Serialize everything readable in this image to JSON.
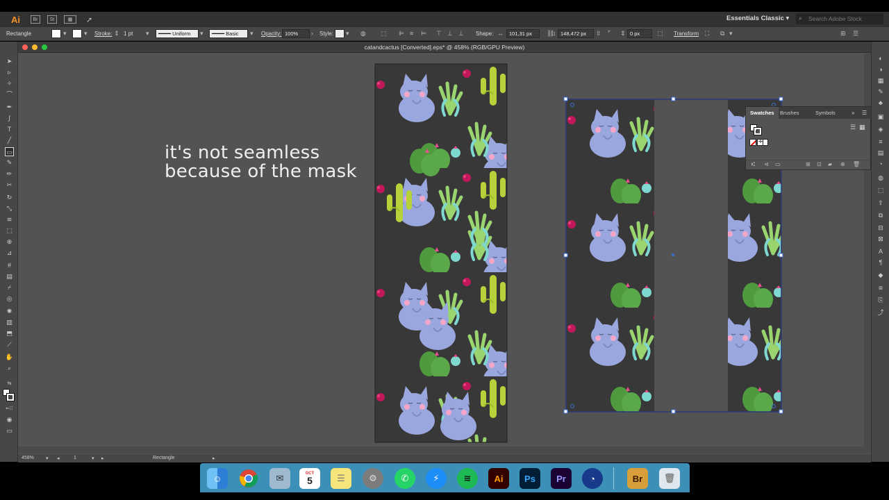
{
  "app": {
    "logo": "Ai",
    "bridge_btn": "Br",
    "stock_btn": "St",
    "workspace": "Essentials Classic",
    "stock_placeholder": "Search Adobe Stock"
  },
  "control": {
    "object_type": "Rectangle",
    "stroke_label": "Stroke:",
    "stroke_weight": "1 pt",
    "profile": "Uniform",
    "brush": "Basic",
    "opacity_label": "Opacity:",
    "opacity": "100%",
    "style_label": "Style:",
    "shape_label": "Shape:",
    "width": "101,31 px",
    "height": "148,472 px",
    "corner": "0 px",
    "transform_label": "Transform"
  },
  "document": {
    "title": "catandcactus [Converted].eps* @ 458% (RGB/GPU Preview)"
  },
  "canvas": {
    "note_line1": "it's not seamless",
    "note_line2": "because of the mask"
  },
  "swatches_panel": {
    "tab_swatches": "Swatches",
    "tab_brushes": "Brushes",
    "tab_symbols": "Symbols"
  },
  "status": {
    "zoom": "458%",
    "artboard": "1",
    "tool": "Rectangle"
  },
  "dock": {
    "calendar_month": "OCT",
    "calendar_day": "5",
    "illustrator": "Ai",
    "photoshop": "Ps",
    "premiere": "Pr",
    "bridge": "Br"
  },
  "colors": {
    "pattern_bg": "#383838",
    "cat": "#9aa7de",
    "cactus_green": "#b6d13a",
    "cactus_dark": "#4f9a3e",
    "mint": "#7fd8d0",
    "magenta": "#c2185b",
    "selection": "#3c6dd6"
  }
}
